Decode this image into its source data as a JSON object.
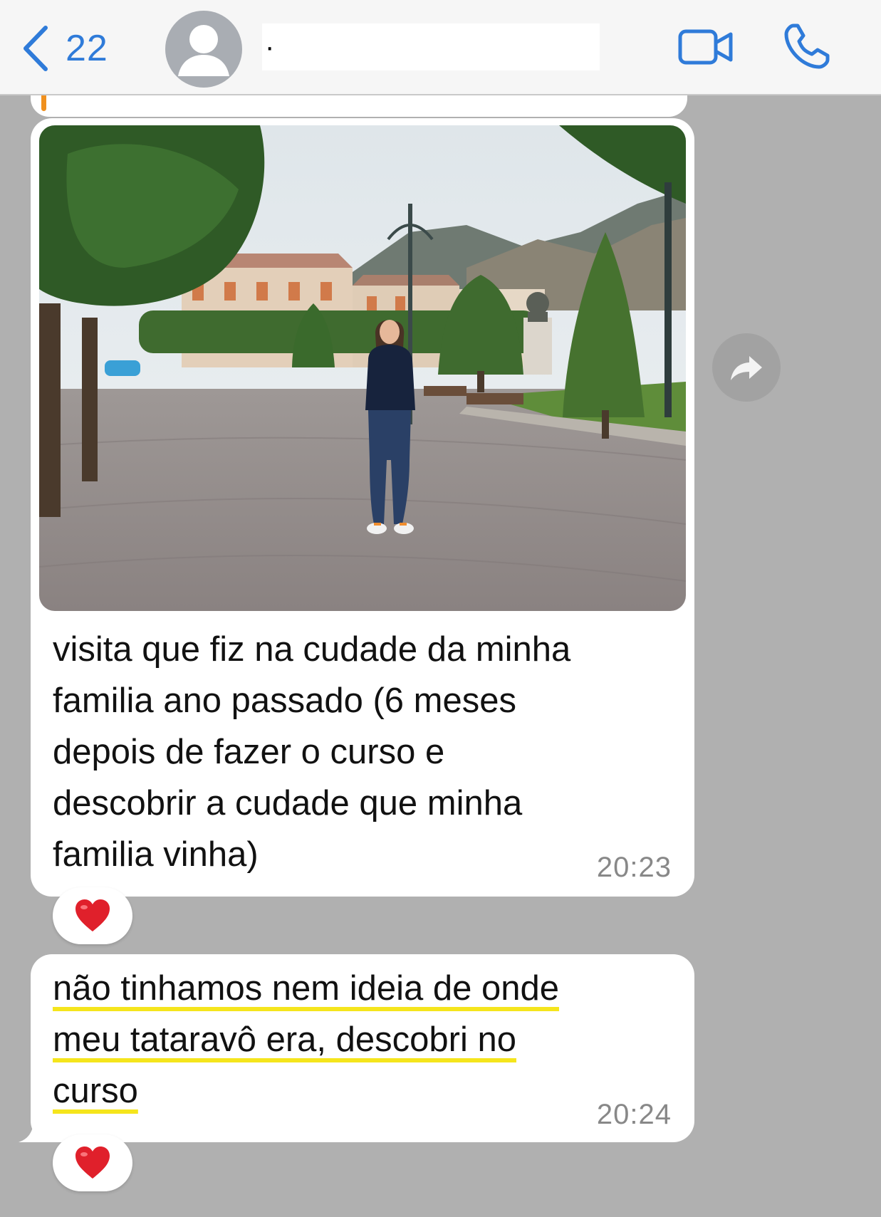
{
  "header": {
    "back_count": "22",
    "contact_name": "·",
    "icons": {
      "back": "chevron-left-icon",
      "avatar": "person-avatar-icon",
      "video": "video-camera-icon",
      "call": "phone-icon"
    },
    "accent_color": "#2f7bd9"
  },
  "messages": [
    {
      "has_photo": true,
      "text": "visita que fiz na cudade da minha\nfamilia ano passado (6 meses\ndepois de fazer o curso e\ndescobrir a cudade que minha\nfamilia vinha)",
      "time": "20:23",
      "reaction": "❤️"
    },
    {
      "lines": [
        "não tinhamos nem ideia de onde",
        "meu tataravô era, descobri no",
        "curso"
      ],
      "time": "20:24",
      "reaction": "❤️",
      "underline_color": "#f5e51c"
    }
  ],
  "colors": {
    "chat_background": "#b0b0b0",
    "bubble": "#ffffff",
    "quote_bar": "#f0901e"
  },
  "forward_icon": "forward-arrow-icon"
}
